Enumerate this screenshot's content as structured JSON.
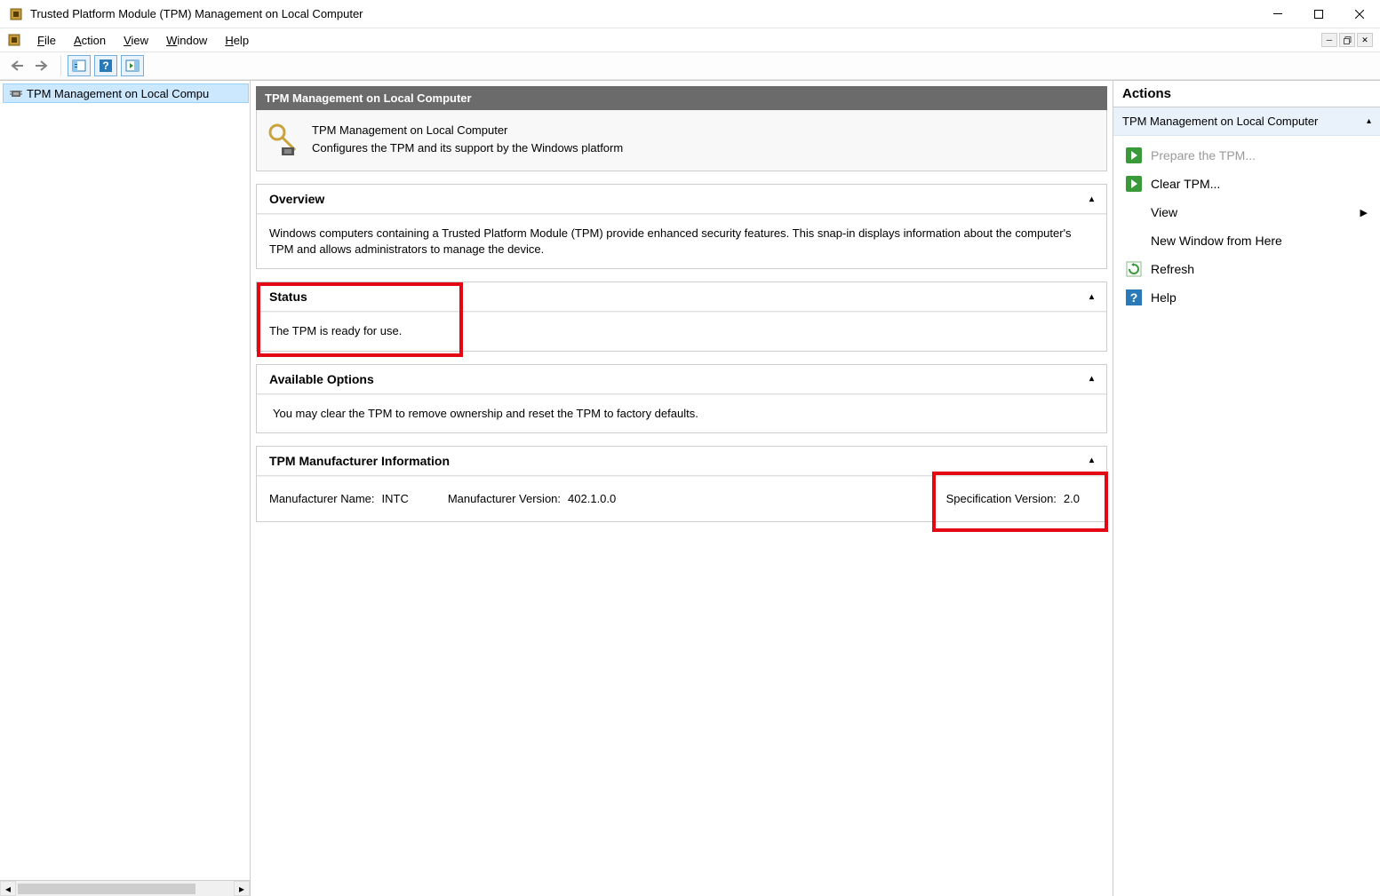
{
  "window": {
    "title": "Trusted Platform Module (TPM) Management on Local Computer"
  },
  "menubar": {
    "file": "File",
    "action": "Action",
    "view": "View",
    "window": "Window",
    "help": "Help"
  },
  "tree": {
    "item0": "TPM Management on Local Compu"
  },
  "center": {
    "header": "TPM Management on Local Computer",
    "intro_title": "TPM Management on Local Computer",
    "intro_desc": "Configures the TPM and its support by the Windows platform",
    "overview": {
      "title": "Overview",
      "body": "Windows computers containing a Trusted Platform Module (TPM) provide enhanced security features. This snap-in displays information about the computer's TPM and allows administrators to manage the device."
    },
    "status": {
      "title": "Status",
      "body": "The TPM is ready for use."
    },
    "options": {
      "title": "Available Options",
      "body": "You may clear the TPM to remove ownership and reset the TPM to factory defaults."
    },
    "mfg": {
      "title": "TPM Manufacturer Information",
      "name_label": "Manufacturer Name:",
      "name_value": "INTC",
      "ver_label": "Manufacturer Version:",
      "ver_value": "402.1.0.0",
      "spec_label": "Specification Version:",
      "spec_value": "2.0"
    }
  },
  "actions": {
    "header": "Actions",
    "subheader": "TPM Management on Local Computer",
    "items": {
      "prepare": "Prepare the TPM...",
      "clear": "Clear TPM...",
      "view": "View",
      "newwin": "New Window from Here",
      "refresh": "Refresh",
      "help": "Help"
    }
  }
}
